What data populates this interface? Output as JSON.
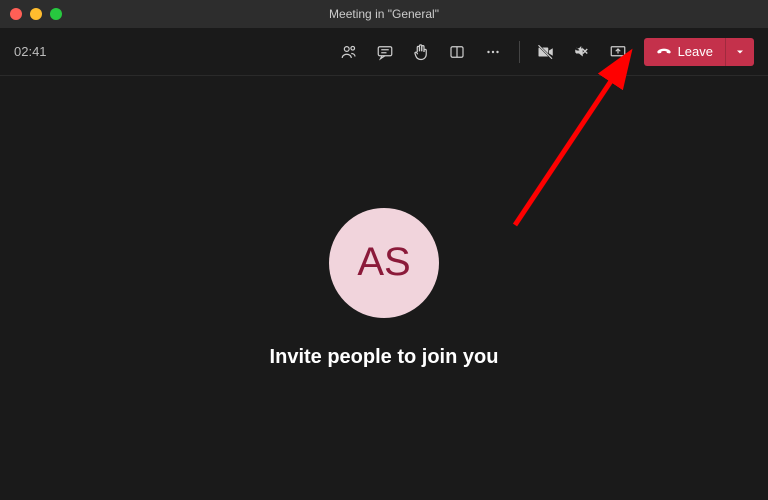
{
  "window": {
    "title": "Meeting in \"General\""
  },
  "toolbar": {
    "timer": "02:41",
    "leave_label": "Leave"
  },
  "main": {
    "avatar_initials": "AS",
    "invite_text": "Invite people to join you"
  },
  "colors": {
    "leave_bg": "#c4314b",
    "arrow": "#ff0000"
  }
}
